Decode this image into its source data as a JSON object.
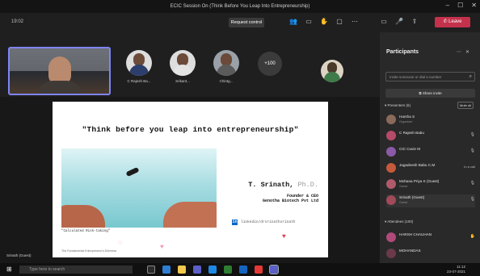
{
  "window": {
    "title": "ECIC Session On (Think Before You Leap Into Entrepreneurship)"
  },
  "toolbar": {
    "elapsed": "19:02",
    "request_control_label": "Request control",
    "leave_label": "Leave"
  },
  "strip": {
    "participants": [
      {
        "name": "C Rajesh Ba..."
      },
      {
        "name": "Srikant..."
      },
      {
        "name": "Chintg..."
      }
    ],
    "more_label": "+100"
  },
  "slide": {
    "title": "\"Think before you leap into entrepreneurship\"",
    "presenter_name": "T. Srinath,",
    "presenter_degree": "Ph.D.",
    "role": "Founder & CEO",
    "org": "Genotha Biotech Pvt Ltd",
    "linkedin_handle": "linkedin/drsrinathsrinath",
    "image_caption": "\"Calculated Risk-taking\"",
    "image_source": "The Fundamental Entrepreneur's Dilemma",
    "linkedin_icon": "linkedin-icon"
  },
  "stage": {
    "caller": "Srinath (Guest)"
  },
  "panel": {
    "title": "Participants",
    "search_placeholder": "Invite someone or dial a number",
    "share_label": "Share invite",
    "presenters_label": "Presenters (6)",
    "mute_all_label": "Mute all",
    "attendees_label": "Attendees (100)",
    "presenters": [
      {
        "name": "Harsha S",
        "sub": "Organizer",
        "status": ""
      },
      {
        "name": "C Rajesh Babu",
        "sub": "",
        "status": ""
      },
      {
        "name": "CIC Cuvie M",
        "sub": "",
        "status": ""
      },
      {
        "name": "Jagadeesh Babu C.M",
        "sub": "",
        "status": "In a call"
      },
      {
        "name": "Mohana Priya K (Guest)",
        "sub": "Guest",
        "status": ""
      },
      {
        "name": "Srinath (Guest)",
        "sub": "Guest",
        "status": ""
      }
    ],
    "attendees": [
      {
        "name": "HARSH CHAUHAN",
        "sub": ""
      },
      {
        "name": "MOHANDAS",
        "sub": ""
      }
    ]
  },
  "taskbar": {
    "search_placeholder": "Type here to search",
    "clock_time": "11:12",
    "clock_date": "23-07-2021"
  },
  "colors": {
    "accent": "#7f85f5",
    "leave": "#c4314b",
    "heart": "#e03d4f",
    "linkedin": "#0a66c2"
  }
}
